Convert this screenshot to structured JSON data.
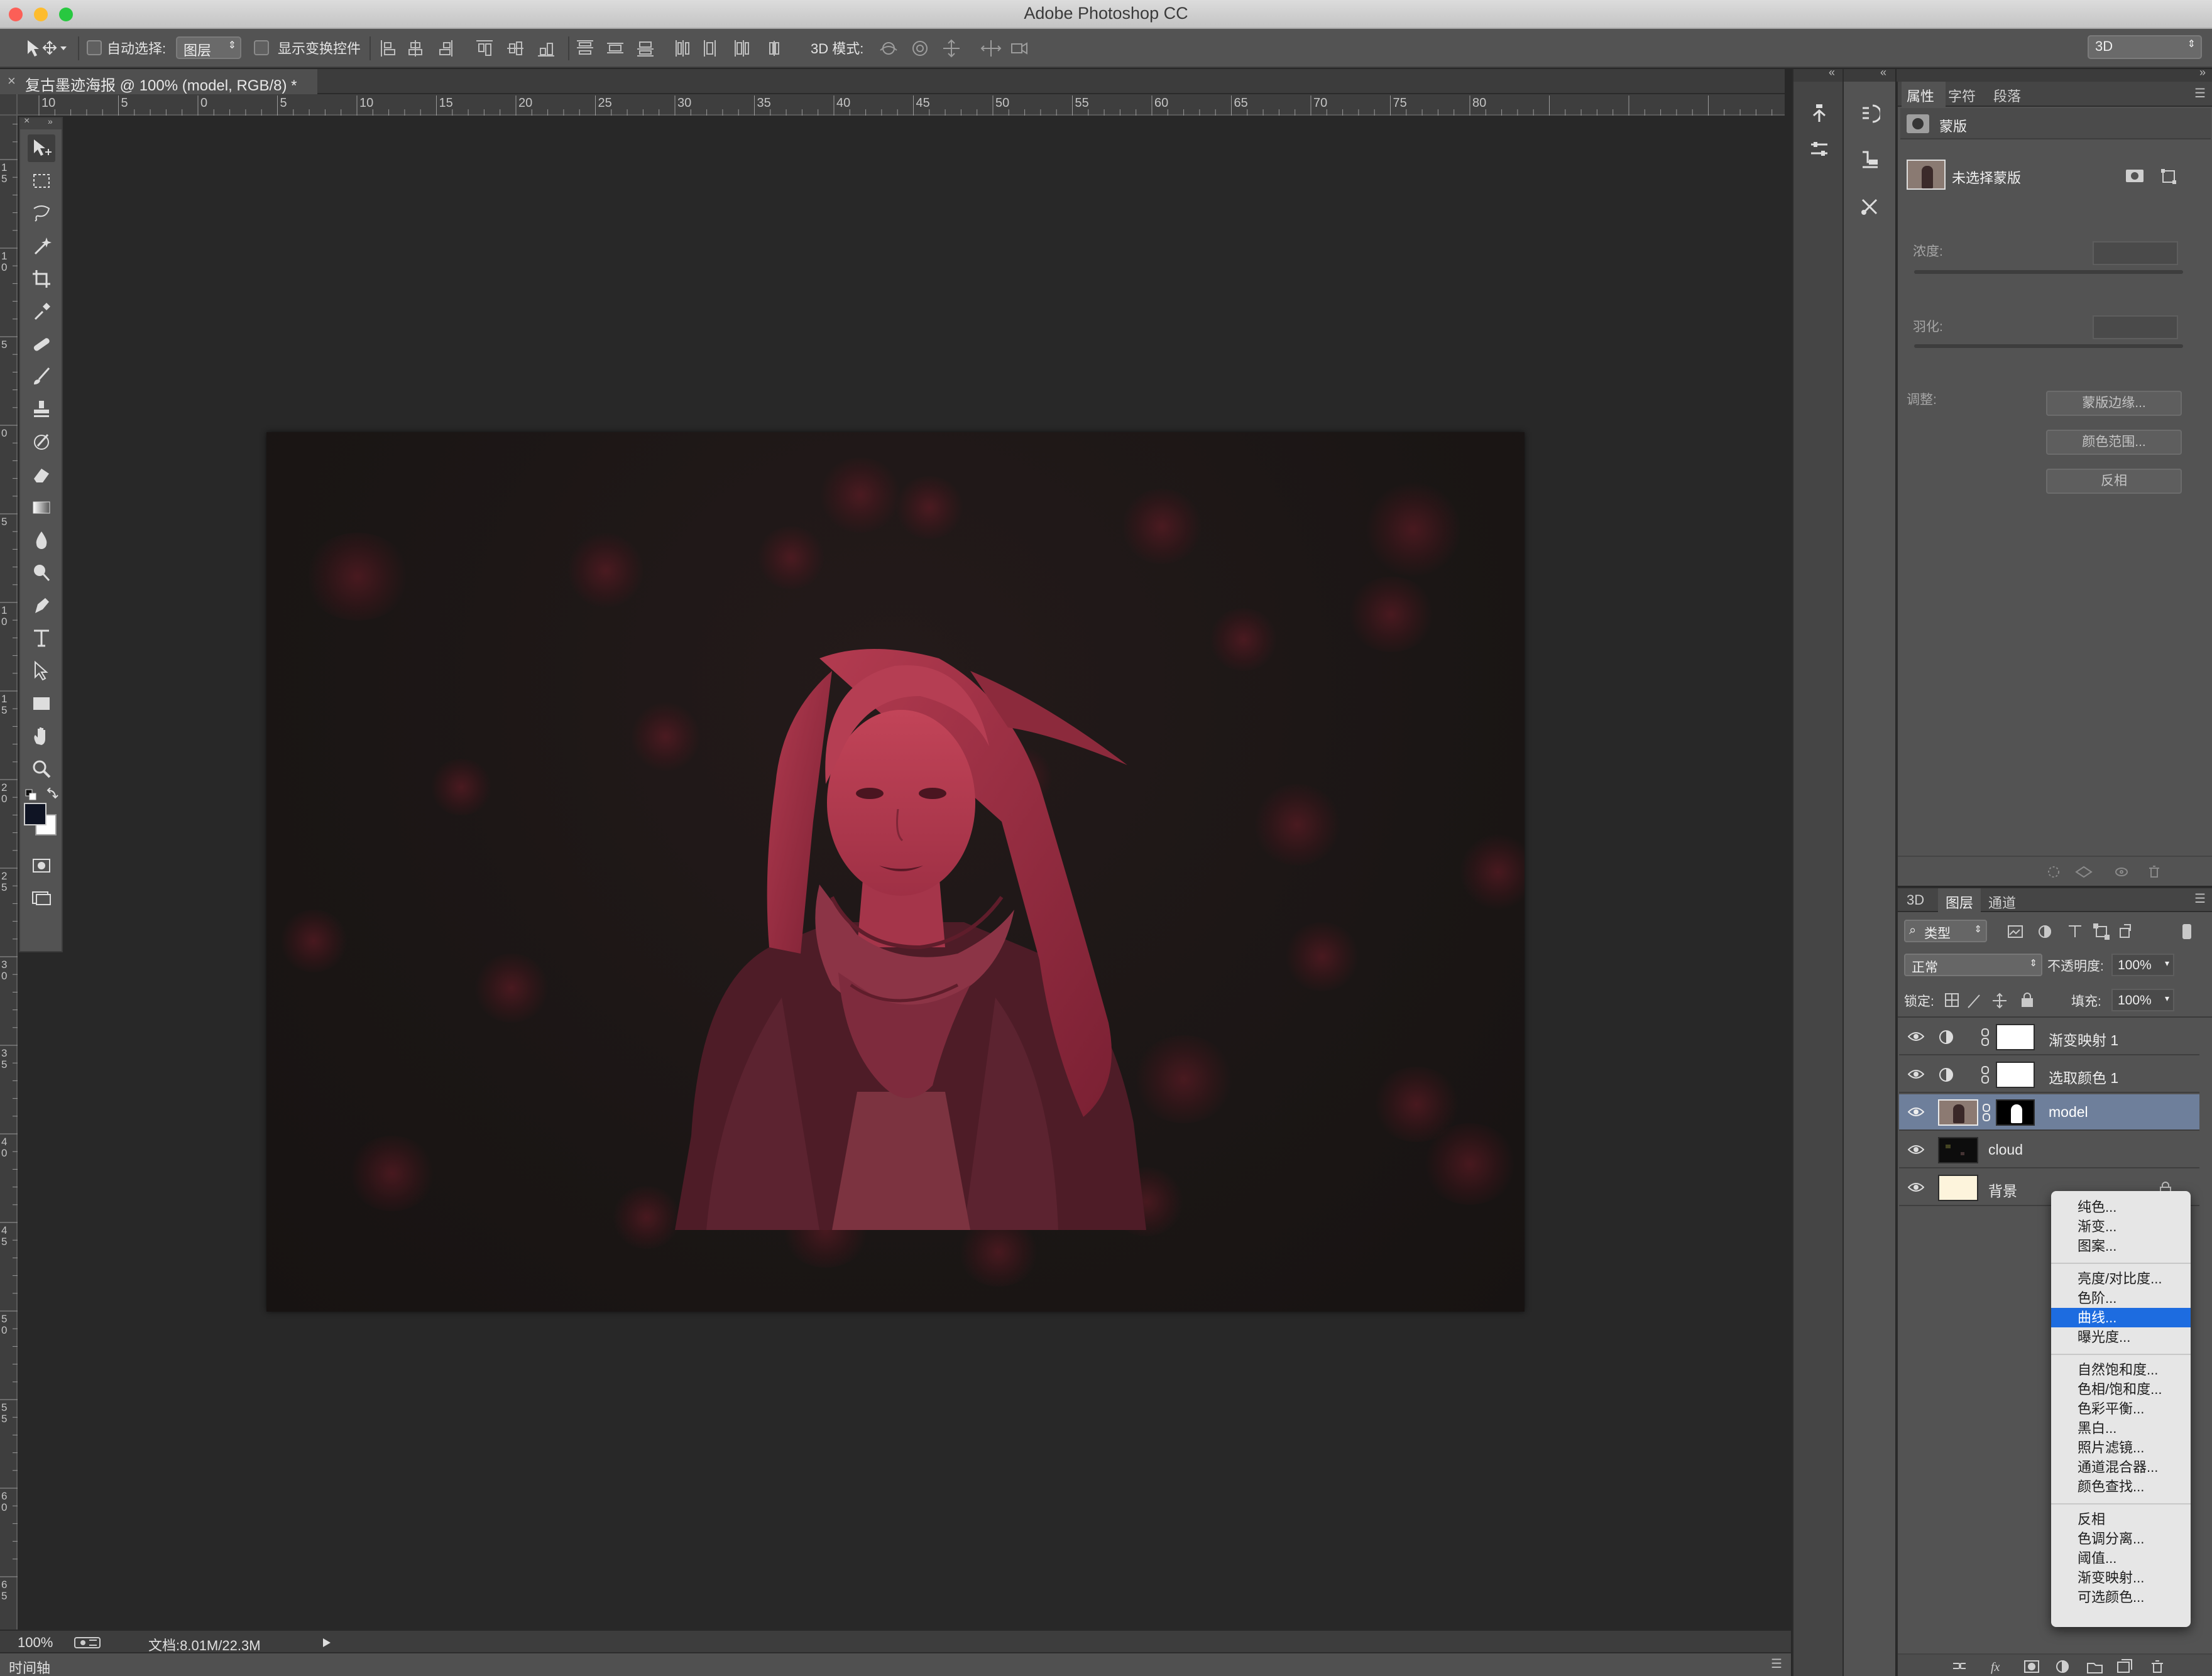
{
  "window": {
    "title": "Adobe Photoshop CC"
  },
  "options_bar": {
    "auto_select_label": "自动选择:",
    "auto_select_value": "图层",
    "show_transform_label": "显示变换控件",
    "mode_3d_label": "3D 模式:",
    "workspace": "3D"
  },
  "document": {
    "tab_title": "复古墨迹海报 @ 100% (model, RGB/8) *",
    "zoom": "100%",
    "doc_size": "文档:8.01M/22.3M",
    "ruler_top": [
      "10",
      "5",
      "0",
      "5",
      "10",
      "15",
      "20",
      "25",
      "30",
      "35",
      "40",
      "45",
      "50",
      "55",
      "60",
      "65",
      "70",
      "75",
      "80"
    ],
    "ruler_left": [
      "1 5",
      "1 0",
      "5",
      "0",
      "5",
      "1 0",
      "1 5",
      "2 0",
      "2 5",
      "3 0",
      "3 5",
      "4 0",
      "4 5",
      "5 0",
      "5 5",
      "6 0",
      "6 5"
    ]
  },
  "status": {
    "timeline": "时间轴"
  },
  "colors": {
    "accent_selected": "#1d6ce0",
    "layer_selected": "#6e7f9b",
    "tint": "#b3354d"
  },
  "properties": {
    "tabs": [
      "属性",
      "字符",
      "段落"
    ],
    "section": "蒙版",
    "mask_status": "未选择蒙版",
    "density_label": "浓度:",
    "feather_label": "羽化:",
    "adjust_label": "调整:",
    "buttons": [
      "蒙版边缘...",
      "颜色范围...",
      "反相"
    ]
  },
  "layers_panel": {
    "tabs": [
      "3D",
      "图层",
      "通道"
    ],
    "filter": "类型",
    "blend_mode": "正常",
    "opacity_label": "不透明度:",
    "opacity": "100%",
    "lock_label": "锁定:",
    "fill_label": "填充:",
    "fill": "100%",
    "layers": [
      {
        "name": "渐变映射 1"
      },
      {
        "name": "选取颜色 1"
      },
      {
        "name": "model"
      },
      {
        "name": "cloud"
      },
      {
        "name": "背景"
      }
    ]
  },
  "adjustment_menu": {
    "group1": [
      "纯色...",
      "渐变...",
      "图案..."
    ],
    "group2": [
      "亮度/对比度...",
      "色阶...",
      "曲线...",
      "曝光度..."
    ],
    "group3": [
      "自然饱和度...",
      "色相/饱和度...",
      "色彩平衡...",
      "黑白...",
      "照片滤镜...",
      "通道混合器...",
      "颜色查找..."
    ],
    "group4": [
      "反相",
      "色调分离...",
      "阈值...",
      "渐变映射...",
      "可选颜色..."
    ],
    "selected": "曲线..."
  }
}
